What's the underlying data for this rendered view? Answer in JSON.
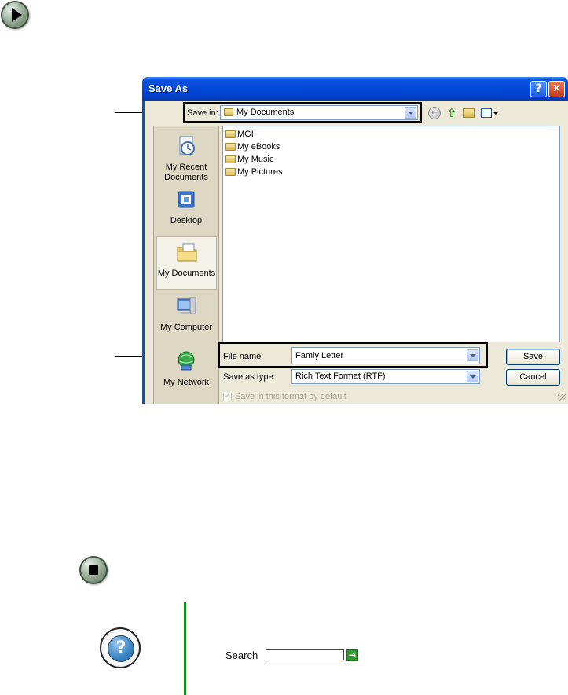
{
  "dialog": {
    "title": "Save As",
    "help_button": "?",
    "close_button": "✕",
    "save_in_label": "Save in:",
    "save_in_value": "My Documents",
    "places": [
      {
        "label": "My Recent Documents",
        "icon": "recent-documents-icon"
      },
      {
        "label": "Desktop",
        "icon": "desktop-icon"
      },
      {
        "label": "My Documents",
        "icon": "my-documents-icon",
        "selected": true
      },
      {
        "label": "My Computer",
        "icon": "my-computer-icon"
      },
      {
        "label": "My Network",
        "icon": "my-network-icon"
      }
    ],
    "files": [
      {
        "name": "MGI"
      },
      {
        "name": "My eBooks"
      },
      {
        "name": "My Music"
      },
      {
        "name": "My Pictures"
      }
    ],
    "file_name_label": "File name:",
    "file_name_value": "Famly Letter",
    "save_as_type_label": "Save as type:",
    "save_as_type_value": "Rich Text Format (RTF)",
    "save_default_label": "Save in this format by default",
    "save_button": "Save",
    "cancel_button": "Cancel"
  },
  "help": {
    "search_label": "Search"
  },
  "colors": {
    "titlebar_blue": "#0047d6",
    "dialog_face": "#ece9d8",
    "rule_green": "#1b8a1b"
  }
}
